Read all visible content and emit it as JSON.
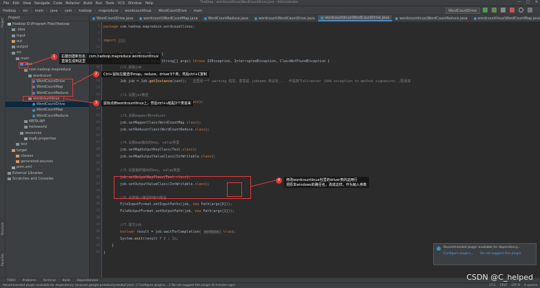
{
  "menubar": {
    "items": [
      "File",
      "Edit",
      "View",
      "Navigate",
      "Code",
      "Refactor",
      "Build",
      "Run",
      "Tools",
      "VCS",
      "Window",
      "Help"
    ],
    "title": "TheDrop - wordcountlinux\\WordCountDrive.java - Administrator",
    "controls": [
      "—",
      "□",
      "✕"
    ]
  },
  "navbar": {
    "crumbs": [
      "Hadoop",
      "src",
      "main",
      "java",
      "com",
      "hadoop",
      "mapreduce",
      "wordcountlinux",
      "WordCountDrive",
      "main"
    ],
    "run_config": "WordCountDrive"
  },
  "colors": {
    "accent": "#4a88c7",
    "annotation_red": "#e03b3b",
    "keyword": "#cc7832",
    "string": "#6a8759",
    "comment": "#808080"
  },
  "project": {
    "header": "Project",
    "tree": [
      {
        "label": "Hadoop  D:\\Program Files\\Hadoop",
        "indent": 0,
        "kind": "module"
      },
      {
        "label": ".idea",
        "indent": 1,
        "kind": "folder"
      },
      {
        "label": "input",
        "indent": 1,
        "kind": "folder"
      },
      {
        "label": "out",
        "indent": 1,
        "kind": "folder-orange"
      },
      {
        "label": "output",
        "indent": 1,
        "kind": "folder"
      },
      {
        "label": "src",
        "indent": 1,
        "kind": "folder"
      },
      {
        "label": "main",
        "indent": 2,
        "kind": "folder"
      },
      {
        "label": "java",
        "indent": 3,
        "kind": "folder-blue"
      },
      {
        "label": "com.hadoop.mapreduce",
        "indent": 4,
        "kind": "package"
      },
      {
        "label": "wordcount",
        "indent": 5,
        "kind": "package"
      },
      {
        "label": "WordCountDrive",
        "indent": 6,
        "kind": "class"
      },
      {
        "label": "WordCountMap",
        "indent": 6,
        "kind": "class"
      },
      {
        "label": "WordCountReduce",
        "indent": 6,
        "kind": "class"
      },
      {
        "label": "wordcountlinux",
        "indent": 5,
        "kind": "package"
      },
      {
        "label": "WordCountDrive",
        "indent": 6,
        "kind": "class",
        "selected": true
      },
      {
        "label": "WordCountMap",
        "indent": 6,
        "kind": "class"
      },
      {
        "label": "WordCountReduce",
        "indent": 6,
        "kind": "class"
      },
      {
        "label": "META-INF",
        "indent": 4,
        "kind": "folder"
      },
      {
        "label": "helloworld",
        "indent": 4,
        "kind": "folder"
      },
      {
        "label": "resources",
        "indent": 3,
        "kind": "folder"
      },
      {
        "label": "log4j.properties",
        "indent": 4,
        "kind": "file"
      },
      {
        "label": "test",
        "indent": 2,
        "kind": "folder"
      },
      {
        "label": "target",
        "indent": 1,
        "kind": "folder-orange"
      },
      {
        "label": "classes",
        "indent": 2,
        "kind": "folder-orange"
      },
      {
        "label": "generated-sources",
        "indent": 2,
        "kind": "folder-orange"
      },
      {
        "label": "pom.xml",
        "indent": 1,
        "kind": "file"
      },
      {
        "label": "External Libraries",
        "indent": 0,
        "kind": "lib"
      },
      {
        "label": "Scratches and Consoles",
        "indent": 0,
        "kind": "lib"
      }
    ]
  },
  "tabs": [
    "WordCountDrive.java",
    "wordcount\\WordCountMap.java",
    "WordCountReduce.java",
    "wordcount\\WordCountDrive.java",
    "wordcountlinux\\WordCountDrive.java",
    "wordcountlinux\\WordCountReduce.java",
    "wordcountlinux\\WordCountMap.java"
  ],
  "active_tab": 4,
  "code": [
    {
      "n": "1",
      "html": "<span class='kw'>package</span> com.hadoop.mapreduce.wordcountlinux;"
    },
    {
      "n": "2",
      "html": ""
    },
    {
      "n": "3",
      "html": "<span class='kw'>import</span> <span class='hint'>...</span>"
    },
    {
      "n": "13",
      "html": ""
    },
    {
      "n": "14",
      "html": "<span class='kw'>public class</span> WordCountDrive {"
    },
    {
      "n": "15",
      "html": "    <span class='kw'>public static void</span> <span class='fn'>main</span>(String[] args) <span class='kw'>throws</span> IOException, InterruptedException, ClassNotFoundException {"
    },
    {
      "n": "16",
      "html": "        <span class='cm'>//1.获取job</span>"
    },
    {
      "n": "17",
      "html": "        Configuration conf = <span class='kw'>new</span> Configuration();"
    },
    {
      "n": "18",
      "html": "        Job job = Job.<span class='fn'>getInstance</span>(conf);   <span class='cm'>这里有一个 warning 信息，意思是 jobname 未设定...  作是按下alt+enter (Add exception to method signature) ,再添加</span>"
    },
    {
      "n": "19",
      "html": ""
    },
    {
      "n": "20",
      "html": "        <span class='cm'>//2.设置jar路径</span>"
    },
    {
      "n": "21",
      "html": "        job.setJarByClass(WordCountDrive.<span class='kw'>class</span>);"
    },
    {
      "n": "22",
      "html": ""
    },
    {
      "n": "23",
      "html": "        <span class='cm'>//3.关联mapper和reducer</span>"
    },
    {
      "n": "24",
      "html": "        job.setMapperClass(WordCountMap.<span class='kw'>class</span>);"
    },
    {
      "n": "25",
      "html": "        job.setReducerClass(WordCountReduce.<span class='kw'>class</span>);"
    },
    {
      "n": "26",
      "html": ""
    },
    {
      "n": "27",
      "html": "        <span class='cm'>//4.设置map输出的key, value类型</span>"
    },
    {
      "n": "28",
      "html": "        job.setMapOutputKeyClass(Text.<span class='kw'>class</span>);"
    },
    {
      "n": "29",
      "html": "        job.setMapOutputValueClass(IntWritable.<span class='kw'>class</span>);"
    },
    {
      "n": "30",
      "html": ""
    },
    {
      "n": "31",
      "html": "        <span class='cm'>//5.设置最终输出的key, value类型</span>"
    },
    {
      "n": "32",
      "html": "        job.setOutputKeyClass(Text.<span class='kw'>class</span>);"
    },
    {
      "n": "33",
      "html": "        job.setOutputValueClass(IntWritable.<span class='kw'>class</span>);"
    },
    {
      "n": "34",
      "html": ""
    },
    {
      "n": "35",
      "html": "        <span class='cm'>//6.设置输入路径和输出路径</span>"
    },
    {
      "n": "36",
      "html": "        FileInputFormat.setInputPaths(job, <span class='kw'>new</span> Path(args[0]));"
    },
    {
      "n": "37",
      "html": "        FileOutputFormat.setOutputPath(job, <span class='kw'>new</span> Path(args[1]));"
    },
    {
      "n": "38",
      "html": ""
    },
    {
      "n": "39",
      "html": "        <span class='cm'>//7.提交job</span>"
    },
    {
      "n": "40",
      "html": "        <span class='kw'>boolean</span> result = job.waitForCompletion( <span class='hint'>verbose:</span> <span class='kw'>true</span>);"
    },
    {
      "n": "41",
      "html": "        System.<span class='fn'>exit</span>(result ? <span class='fld'>0</span> : <span class='fld'>1</span>);"
    },
    {
      "n": "42",
      "html": "    }"
    },
    {
      "n": "43",
      "html": "}"
    }
  ],
  "annotations": [
    {
      "num": "1",
      "text": "右键创建新包名：com.hadoop.mapreduce.wordcountlinux\n直接生成到这里"
    },
    {
      "num": "2",
      "text": "Ctrl+鼠标左键选中map，reduce，driver3个类，然后ctrl+C复制"
    },
    {
      "num": "3",
      "text": "鼠标点到wordcountlinux上，然后ctrl+v粘贴3个类进来"
    },
    {
      "num": "4",
      "text": "修改wordcountlinux包里的driver类的这两行\n把原本windows的路径名，改成这样，作为输入参数"
    }
  ],
  "notification": {
    "title": "Recommended plugin available for dependency...",
    "link1": "Configure plugins...",
    "link2": "Do not suggest this plugin"
  },
  "bottom_tabs": [
    "TODO",
    "Problems",
    "Terminal",
    "Build",
    "Dependencies"
  ],
  "status": {
    "message": "Recommended plugin available for dependency 'javacom.google.protobuf:protobuf-java': // Configure plugins... // Do not suggest this plugin (9 minutes ago)",
    "right": [
      "37:1",
      "CRLF",
      "UTF-8",
      "4 spaces"
    ]
  },
  "watermark": "CSDN @C_helped",
  "side_tabs": [
    "Project",
    "Structure",
    "Favorites"
  ]
}
